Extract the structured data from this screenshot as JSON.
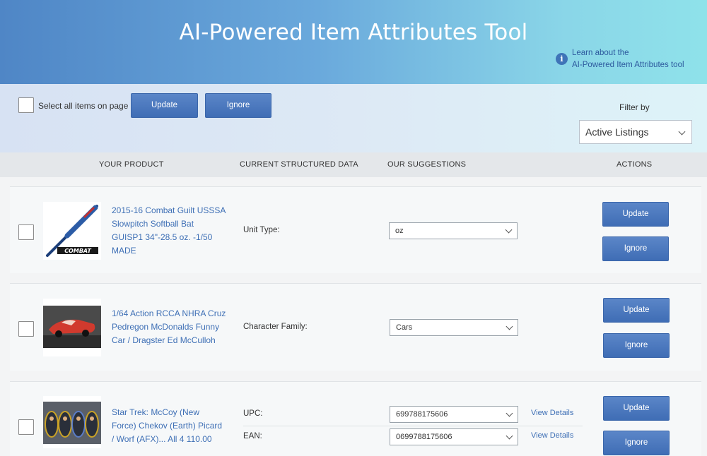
{
  "header": {
    "title": "AI-Powered Item Attributes Tool",
    "learn_line1": "Learn about the",
    "learn_line2": "AI-Powered Item Attributes tool",
    "info_icon": "info-icon",
    "info_glyph": "i"
  },
  "toolbar": {
    "select_all_label": "Select all items on page",
    "update_label": "Update",
    "ignore_label": "Ignore",
    "filter_label": "Filter by",
    "filter_value": "Active Listings"
  },
  "columns": {
    "product": "YOUR PRODUCT",
    "current": "CURRENT STRUCTURED DATA",
    "suggestions": "OUR SUGGESTIONS",
    "actions": "ACTIONS"
  },
  "items": [
    {
      "title_lines": [
        "2015-16 Combat Guilt USSSA",
        "Slowpitch Softball Bat",
        "GUISP1 34\"-28.5 oz. -1/50",
        "MADE"
      ],
      "attributes": [
        {
          "label": "Unit Type:",
          "value": "oz"
        }
      ],
      "update_label": "Update",
      "ignore_label": "Ignore",
      "thumb_brand": "COMBAT"
    },
    {
      "title_lines": [
        "1/64 Action RCCA NHRA Cruz",
        "Pedregon McDonalds Funny",
        "Car / Dragster Ed McCulloh"
      ],
      "attributes": [
        {
          "label": "Character Family:",
          "value": "Cars"
        }
      ],
      "update_label": "Update",
      "ignore_label": "Ignore"
    },
    {
      "title_lines": [
        "Star Trek: McCoy (New",
        "Force) Chekov (Earth) Picard",
        "/ Worf (AFX)... All 4 110.00"
      ],
      "attributes": [
        {
          "label": "UPC:",
          "value": "699788175606",
          "link": "View Details"
        },
        {
          "label": "EAN:",
          "value": "0699788175606",
          "link": "View Details"
        }
      ],
      "update_label": "Update",
      "ignore_label": "Ignore"
    }
  ]
}
